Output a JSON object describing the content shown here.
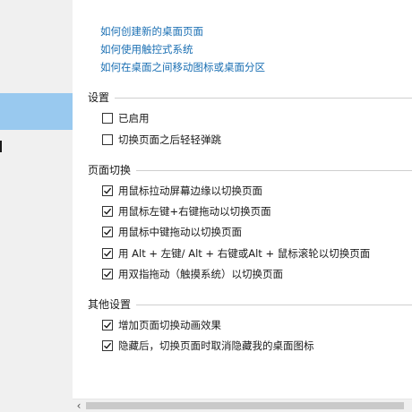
{
  "links": [
    "如何创建新的桌面页面",
    "如何使用触控式系统",
    "如何在桌面之间移动图标或桌面分区"
  ],
  "sections": {
    "settings": {
      "title": "设置",
      "options": [
        {
          "label": "已启用",
          "checked": false
        },
        {
          "label": "切换页面之后轻轻弹跳",
          "checked": false
        }
      ]
    },
    "page_switch": {
      "title": "页面切换",
      "options": [
        {
          "label": "用鼠标拉动屏幕边缘以切换页面",
          "checked": true
        },
        {
          "label": "用鼠标左键+右键拖动以切换页面",
          "checked": true
        },
        {
          "label": "用鼠标中键拖动以切换页面",
          "checked": true
        },
        {
          "label": "用 Alt + 左键/ Alt + 右键或Alt + 鼠标滚轮以切换页面",
          "checked": true
        },
        {
          "label": "用双指拖动（触摸系统）以切换页面",
          "checked": true
        }
      ]
    },
    "other": {
      "title": "其他设置",
      "options": [
        {
          "label": "增加页面切换动画效果",
          "checked": true
        },
        {
          "label": "隐藏后，切换页面时取消隐藏我的桌面图标",
          "checked": true
        }
      ]
    }
  },
  "scrollbar": {
    "left_arrow": "‹"
  },
  "colors": {
    "link": "#1a6fb3",
    "selection": "#99c9ef",
    "sidebar": "#f0f0f0"
  }
}
